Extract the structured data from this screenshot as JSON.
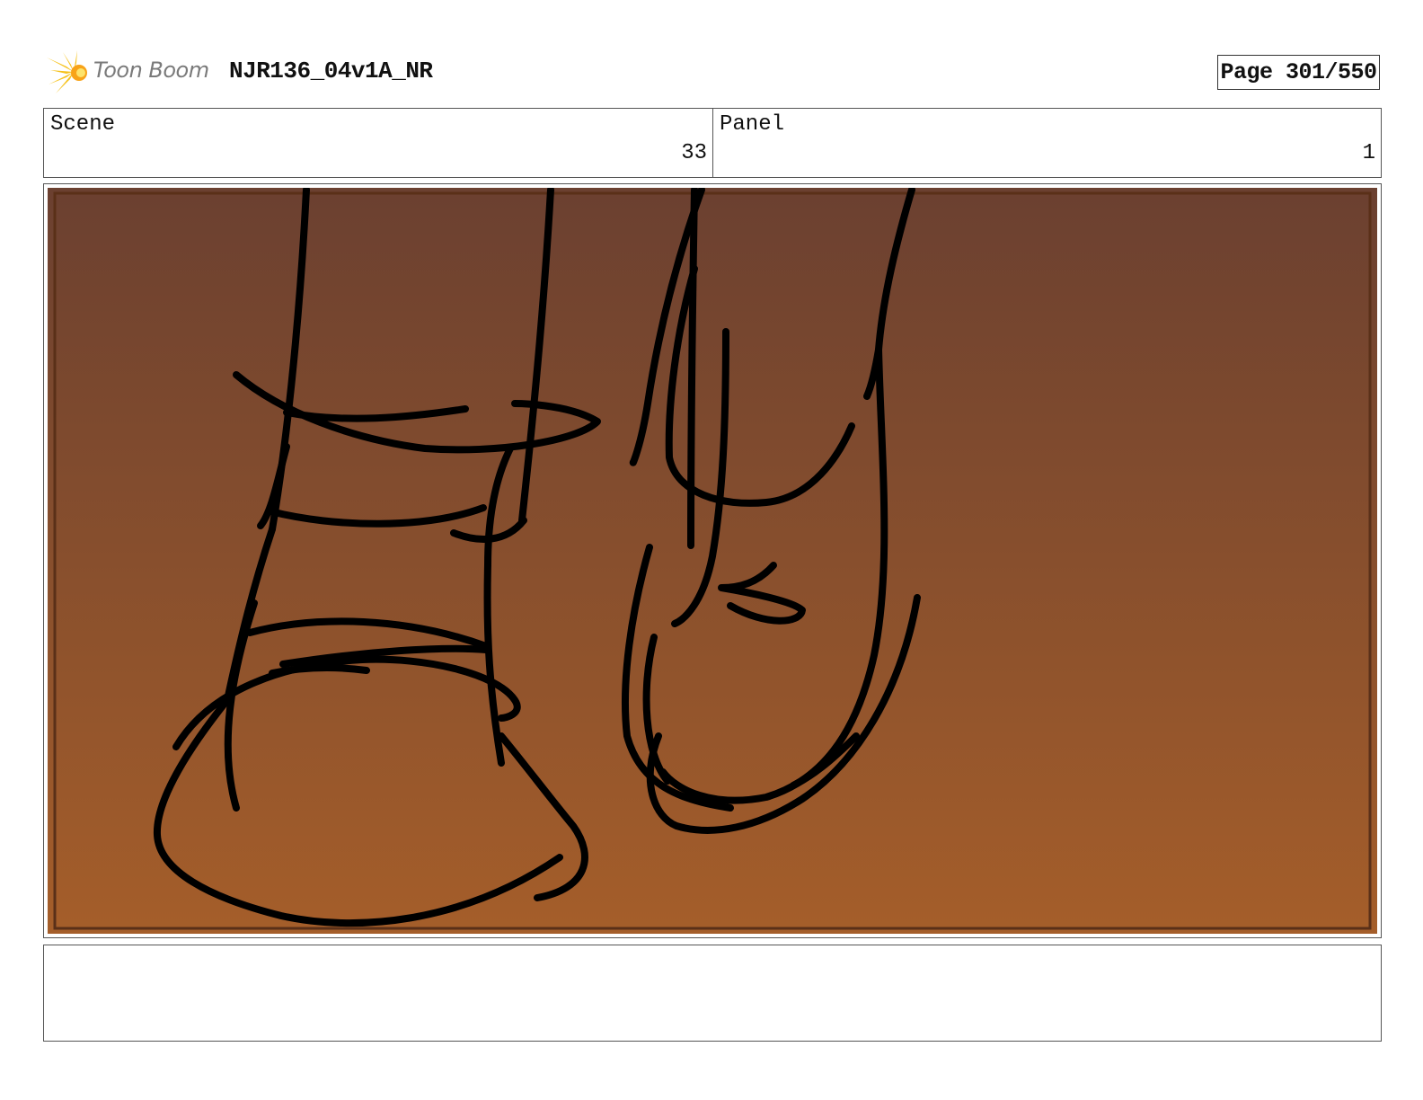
{
  "header": {
    "logo_text": "Toon Boom",
    "project_title": "NJR136_04v1A_NR",
    "page_label": "Page 301/550"
  },
  "info": {
    "scene_label": "Scene",
    "scene_number": "33",
    "panel_label": "Panel",
    "panel_number": "1"
  },
  "panel_image": {
    "description_icon": "sketch-of-two-feet",
    "colors": {
      "gradient_top": "#6b4030",
      "gradient_bottom": "#a55e2a",
      "inner_border": "#5a3018",
      "ink": "#000000"
    }
  },
  "notes": {
    "text": ""
  }
}
